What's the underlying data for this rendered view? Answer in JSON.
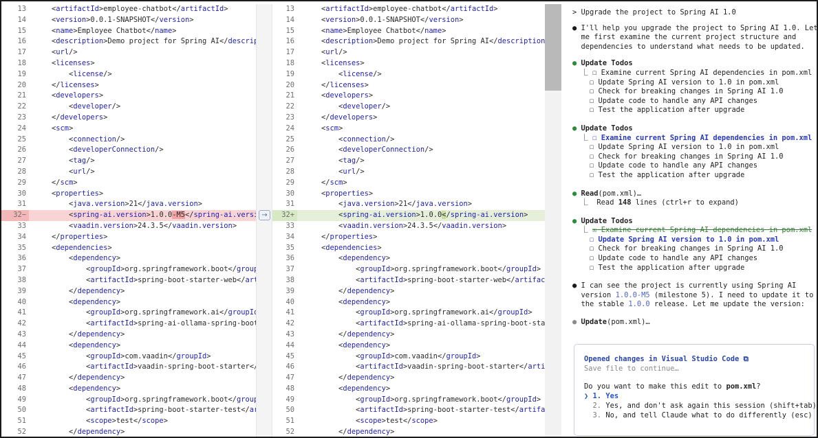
{
  "left_pane": {
    "lines": [
      {
        "n": "13",
        "indent": 1,
        "html": "&lt;<t>artifactId</t>&gt;employee-chatbot&lt;/<t>artifactId</t>&gt;"
      },
      {
        "n": "14",
        "indent": 1,
        "html": "&lt;<t>version</t>&gt;0.0.1-SNAPSHOT&lt;/<t>version</t>&gt;"
      },
      {
        "n": "15",
        "indent": 1,
        "html": "&lt;<t>name</t>&gt;Employee Chatbot&lt;/<t>name</t>&gt;"
      },
      {
        "n": "16",
        "indent": 1,
        "html": "&lt;<t>description</t>&gt;Demo project for Spring AI&lt;/<t>descrip</t>"
      },
      {
        "n": "17",
        "indent": 1,
        "html": "&lt;<t>url</t>/&gt;"
      },
      {
        "n": "18",
        "indent": 1,
        "html": "&lt;<t>licenses</t>&gt;"
      },
      {
        "n": "19",
        "indent": 2,
        "html": "&lt;<t>license</t>/&gt;"
      },
      {
        "n": "20",
        "indent": 1,
        "html": "&lt;/<t>licenses</t>&gt;"
      },
      {
        "n": "21",
        "indent": 1,
        "html": "&lt;<t>developers</t>&gt;"
      },
      {
        "n": "22",
        "indent": 2,
        "html": "&lt;<t>developer</t>/&gt;"
      },
      {
        "n": "23",
        "indent": 1,
        "html": "&lt;/<t>developers</t>&gt;"
      },
      {
        "n": "24",
        "indent": 1,
        "html": "&lt;<t>scm</t>&gt;"
      },
      {
        "n": "25",
        "indent": 2,
        "html": "&lt;<t>connection</t>/&gt;"
      },
      {
        "n": "26",
        "indent": 2,
        "html": "&lt;<t>developerConnection</t>/&gt;"
      },
      {
        "n": "27",
        "indent": 2,
        "html": "&lt;<t>tag</t>/&gt;"
      },
      {
        "n": "28",
        "indent": 2,
        "html": "&lt;<t>url</t>/&gt;"
      },
      {
        "n": "29",
        "indent": 1,
        "html": "&lt;/<t>scm</t>&gt;"
      },
      {
        "n": "30",
        "indent": 1,
        "html": "&lt;<t>properties</t>&gt;"
      },
      {
        "n": "31",
        "indent": 2,
        "html": "&lt;<t>java.version</t>&gt;21&lt;/<t>java.version</t>&gt;"
      },
      {
        "n": "32",
        "indent": 2,
        "html": "&lt;<t>spring-ai.version</t>&gt;1.0.0<del>-M5</del>&lt;/<t>spring-ai.versi</t>",
        "state": "removed",
        "marker": "−"
      },
      {
        "n": "33",
        "indent": 2,
        "html": "&lt;<t>vaadin.version</t>&gt;24.3.5&lt;/<t>vaadin.version</t>&gt;"
      },
      {
        "n": "34",
        "indent": 1,
        "html": "&lt;/<t>properties</t>&gt;"
      },
      {
        "n": "35",
        "indent": 1,
        "html": "&lt;<t>dependencies</t>&gt;"
      },
      {
        "n": "36",
        "indent": 2,
        "html": "&lt;<t>dependency</t>&gt;"
      },
      {
        "n": "37",
        "indent": 3,
        "html": "&lt;<t>groupId</t>&gt;org.springframework.boot&lt;/<t>group</t>"
      },
      {
        "n": "38",
        "indent": 3,
        "html": "&lt;<t>artifactId</t>&gt;spring-boot-starter-web&lt;/<t>art</t>"
      },
      {
        "n": "39",
        "indent": 2,
        "html": "&lt;/<t>dependency</t>&gt;"
      },
      {
        "n": "40",
        "indent": 2,
        "html": "&lt;<t>dependency</t>&gt;"
      },
      {
        "n": "41",
        "indent": 3,
        "html": "&lt;<t>groupId</t>&gt;org.springframework.ai&lt;/<t>groupId</t>"
      },
      {
        "n": "42",
        "indent": 3,
        "html": "&lt;<t>artifactId</t>&gt;spring-ai-ollama-spring-boot"
      },
      {
        "n": "43",
        "indent": 2,
        "html": "&lt;/<t>dependency</t>&gt;"
      },
      {
        "n": "44",
        "indent": 2,
        "html": "&lt;<t>dependency</t>&gt;"
      },
      {
        "n": "45",
        "indent": 3,
        "html": "&lt;<t>groupId</t>&gt;com.vaadin&lt;/<t>groupId</t>&gt;"
      },
      {
        "n": "46",
        "indent": 3,
        "html": "&lt;<t>artifactId</t>&gt;vaadin-spring-boot-starter&lt;/"
      },
      {
        "n": "47",
        "indent": 2,
        "html": "&lt;/<t>dependency</t>&gt;"
      },
      {
        "n": "48",
        "indent": 2,
        "html": "&lt;<t>dependency</t>&gt;"
      },
      {
        "n": "49",
        "indent": 3,
        "html": "&lt;<t>groupId</t>&gt;org.springframework.boot&lt;/<t>group</t>"
      },
      {
        "n": "50",
        "indent": 3,
        "html": "&lt;<t>artifactId</t>&gt;spring-boot-starter-test&lt;/<t>ar</t>"
      },
      {
        "n": "51",
        "indent": 3,
        "html": "&lt;<t>scope</t>&gt;test&lt;/<t>scope</t>&gt;"
      },
      {
        "n": "52",
        "indent": 2,
        "html": "&lt;/<t>dependency</t>&gt;"
      }
    ]
  },
  "right_pane": {
    "lines": [
      {
        "n": "13",
        "indent": 1,
        "html": "&lt;<t>artifactId</t>&gt;employee-chatbot&lt;/<t>artifactId</t>&gt;"
      },
      {
        "n": "14",
        "indent": 1,
        "html": "&lt;<t>version</t>&gt;0.0.1-SNAPSHOT&lt;/<t>version</t>&gt;"
      },
      {
        "n": "15",
        "indent": 1,
        "html": "&lt;<t>name</t>&gt;Employee Chatbot&lt;/<t>name</t>&gt;"
      },
      {
        "n": "16",
        "indent": 1,
        "html": "&lt;<t>description</t>&gt;Demo project for Spring AI&lt;/<t>description</t>&gt;"
      },
      {
        "n": "17",
        "indent": 1,
        "html": "&lt;<t>url</t>/&gt;"
      },
      {
        "n": "18",
        "indent": 1,
        "html": "&lt;<t>licenses</t>&gt;"
      },
      {
        "n": "19",
        "indent": 2,
        "html": "&lt;<t>license</t>/&gt;"
      },
      {
        "n": "20",
        "indent": 1,
        "html": "&lt;/<t>licenses</t>&gt;"
      },
      {
        "n": "21",
        "indent": 1,
        "html": "&lt;<t>developers</t>&gt;"
      },
      {
        "n": "22",
        "indent": 2,
        "html": "&lt;<t>developer</t>/&gt;"
      },
      {
        "n": "23",
        "indent": 1,
        "html": "&lt;/<t>developers</t>&gt;"
      },
      {
        "n": "24",
        "indent": 1,
        "html": "&lt;<t>scm</t>&gt;"
      },
      {
        "n": "25",
        "indent": 2,
        "html": "&lt;<t>connection</t>/&gt;"
      },
      {
        "n": "26",
        "indent": 2,
        "html": "&lt;<t>developerConnection</t>/&gt;"
      },
      {
        "n": "27",
        "indent": 2,
        "html": "&lt;<t>tag</t>/&gt;"
      },
      {
        "n": "28",
        "indent": 2,
        "html": "&lt;<t>url</t>/&gt;"
      },
      {
        "n": "29",
        "indent": 1,
        "html": "&lt;/<t>scm</t>&gt;"
      },
      {
        "n": "30",
        "indent": 1,
        "html": "&lt;<t>properties</t>&gt;"
      },
      {
        "n": "31",
        "indent": 2,
        "html": "&lt;<t>java.version</t>&gt;21&lt;/<t>java.version</t>&gt;"
      },
      {
        "n": "32",
        "indent": 2,
        "html": "&lt;<t>spring-ai.version</t>&gt;1.0.0<add>&lt;</add>/<t>spring-ai.version</t>&gt;",
        "state": "added",
        "marker": "+"
      },
      {
        "n": "33",
        "indent": 2,
        "html": "&lt;<t>vaadin.version</t>&gt;24.3.5&lt;/<t>vaadin.version</t>&gt;"
      },
      {
        "n": "34",
        "indent": 1,
        "html": "&lt;/<t>properties</t>&gt;"
      },
      {
        "n": "35",
        "indent": 1,
        "html": "&lt;<t>dependencies</t>&gt;"
      },
      {
        "n": "36",
        "indent": 2,
        "html": "&lt;<t>dependency</t>&gt;"
      },
      {
        "n": "37",
        "indent": 3,
        "html": "&lt;<t>groupId</t>&gt;org.springframework.boot&lt;/<t>groupId</t>&gt;"
      },
      {
        "n": "38",
        "indent": 3,
        "html": "&lt;<t>artifactId</t>&gt;spring-boot-starter-web&lt;/<t>artifact</t>"
      },
      {
        "n": "39",
        "indent": 2,
        "html": "&lt;/<t>dependency</t>&gt;"
      },
      {
        "n": "40",
        "indent": 2,
        "html": "&lt;<t>dependency</t>&gt;"
      },
      {
        "n": "41",
        "indent": 3,
        "html": "&lt;<t>groupId</t>&gt;org.springframework.ai&lt;/<t>groupId</t>&gt;"
      },
      {
        "n": "42",
        "indent": 3,
        "html": "&lt;<t>artifactId</t>&gt;spring-ai-ollama-spring-boot-star"
      },
      {
        "n": "43",
        "indent": 2,
        "html": "&lt;/<t>dependency</t>&gt;"
      },
      {
        "n": "44",
        "indent": 2,
        "html": "&lt;<t>dependency</t>&gt;"
      },
      {
        "n": "45",
        "indent": 3,
        "html": "&lt;<t>groupId</t>&gt;com.vaadin&lt;/<t>groupId</t>&gt;"
      },
      {
        "n": "46",
        "indent": 3,
        "html": "&lt;<t>artifactId</t>&gt;vaadin-spring-boot-starter&lt;/<t>arti</t>"
      },
      {
        "n": "47",
        "indent": 2,
        "html": "&lt;/<t>dependency</t>&gt;"
      },
      {
        "n": "48",
        "indent": 2,
        "html": "&lt;<t>dependency</t>&gt;"
      },
      {
        "n": "49",
        "indent": 3,
        "html": "&lt;<t>groupId</t>&gt;org.springframework.boot&lt;/<t>groupId</t>&gt;"
      },
      {
        "n": "50",
        "indent": 3,
        "html": "&lt;<t>artifactId</t>&gt;spring-boot-starter-test&lt;/<t>artifac</t>"
      },
      {
        "n": "51",
        "indent": 3,
        "html": "&lt;<t>scope</t>&gt;test&lt;/<t>scope</t>&gt;"
      },
      {
        "n": "52",
        "indent": 2,
        "html": "&lt;/<t>dependency</t>&gt;"
      }
    ]
  },
  "diff": {
    "arrow_glyph": "→"
  },
  "terminal": {
    "prompt": "> Upgrade the project to Spring AI 1.0",
    "intro": [
      "I'll help you upgrade the project to Spring AI 1.0. Let",
      "me first examine the current project structure and",
      "dependencies to understand what needs to be updated."
    ],
    "todos_title": "Update Todos",
    "todos": [
      "Examine current Spring AI dependencies in pom.xml",
      "Update Spring AI version to 1.0 in pom.xml",
      "Check for breaking changes in Spring AI 1.0",
      "Update code to handle any API changes",
      "Test the application after upgrade"
    ],
    "read_label": "Read",
    "read_arg": "(pom.xml)…",
    "read_result_pre": "Read ",
    "read_result_count": "148",
    "read_result_post": " lines (ctrl+r to expand)",
    "analysis_1": "I can see the project is currently using Spring AI",
    "analysis_2_pre": "version ",
    "analysis_2_ver": "1.0.0-M5",
    "analysis_2_post": " (milestone 5). I need to update it to",
    "analysis_3_pre": "the stable ",
    "analysis_3_ver": "1.0.0",
    "analysis_3_post": " release. Let me update the version:",
    "update_label": "Update",
    "update_arg": "(pom.xml)…",
    "dialog": {
      "title": "Opened changes in Visual Studio Code ⧉",
      "subtitle": "Save file to continue…",
      "question_pre": "Do you want to make this edit to ",
      "question_file": "pom.xml",
      "question_post": "?",
      "options": [
        {
          "marker": "❯",
          "num": "1.",
          "label": "Yes"
        },
        {
          "marker": " ",
          "num": "2.",
          "label": "Yes, and don't ask again this session (shift+tab)"
        },
        {
          "marker": " ",
          "num": "3.",
          "label": "No, and tell Claude what to do differently (esc)"
        }
      ]
    }
  }
}
